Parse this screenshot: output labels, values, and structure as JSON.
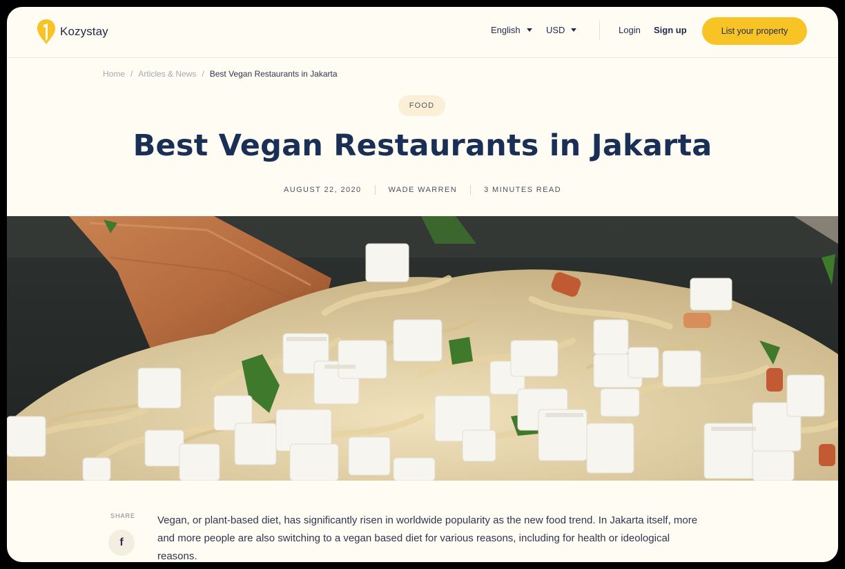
{
  "header": {
    "brand": "Kozystay",
    "language": "English",
    "currency": "USD",
    "login": "Login",
    "signup": "Sign up",
    "cta": "List your property"
  },
  "breadcrumb": [
    "Home",
    "Articles & News",
    "Best Vegan Restaurants in Jakarta"
  ],
  "article": {
    "tag": "FOOD",
    "title": "Best Vegan Restaurants in Jakarta",
    "date": "AUGUST 22, 2020",
    "author": "WADE WARREN",
    "read_time": "3 MINUTES READ",
    "share_label": "SHARE",
    "share_icon": "facebook-icon",
    "body": "Vegan, or plant-based diet, has significantly risen in worldwide popularity as the new food trend.  In Jakarta itself, more and more people are also switching to a vegan based diet for various reasons, including for health or ideological reasons."
  },
  "colors": {
    "background": "#fffcf3",
    "accent": "#f8c324",
    "title": "#1a2f55"
  }
}
